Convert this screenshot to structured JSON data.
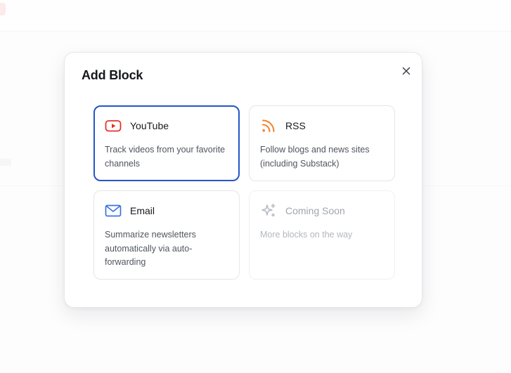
{
  "modal": {
    "title": "Add Block",
    "close_icon": "close-icon"
  },
  "blocks": [
    {
      "title": "YouTube",
      "description": "Track videos from your favorite channels",
      "icon": "youtube-icon",
      "icon_color": "#e5312b",
      "selected": true
    },
    {
      "title": "RSS",
      "description": "Follow blogs and news sites (including Substack)",
      "icon": "rss-icon",
      "icon_color": "#f0822a"
    },
    {
      "title": "Email",
      "description": "Summarize newsletters automatically via auto-forwarding",
      "icon": "mail-icon",
      "icon_color": "#3b73e0"
    },
    {
      "title": "Coming Soon",
      "description": "More blocks on the way",
      "icon": "sparkles-icon",
      "icon_color": "#b7bbc3",
      "disabled": true
    }
  ],
  "colors": {
    "accent": "#2456c7"
  }
}
